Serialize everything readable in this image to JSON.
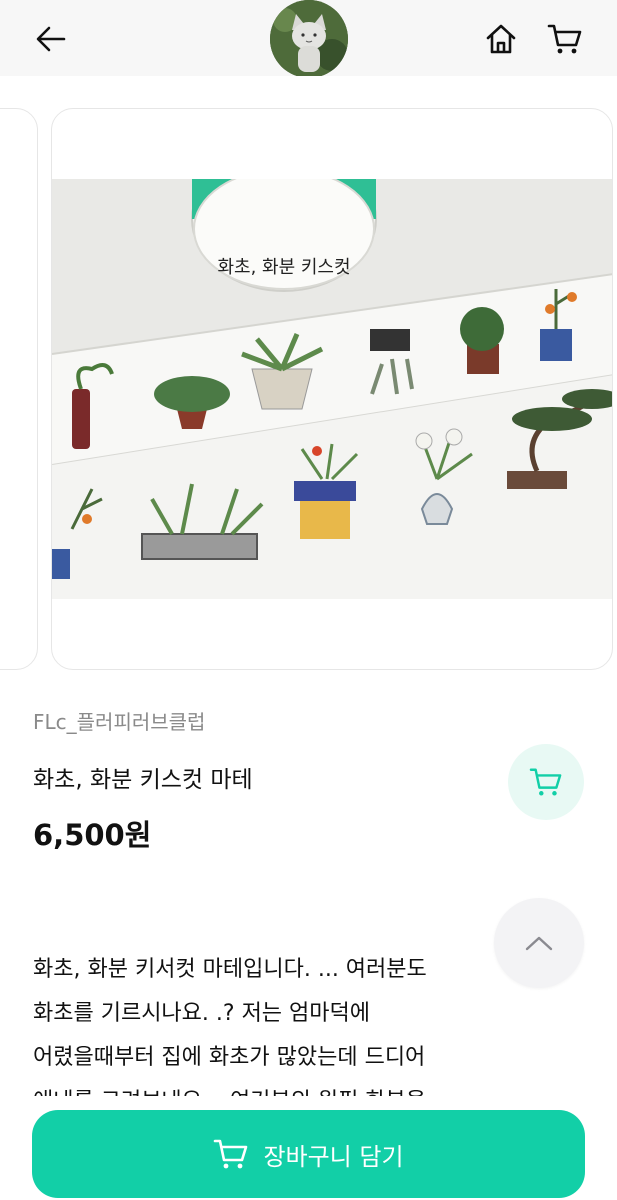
{
  "header": {
    "back_icon": "arrow-left-icon",
    "avatar_icon": "cat-figure-avatar",
    "home_icon": "home-icon",
    "cart_icon": "cart-icon"
  },
  "product": {
    "seller": "FLc_플러피러브클럽",
    "name": "화초, 화분 키스컷 마테",
    "price": "6,500원",
    "description_lines": [
      "화초, 화분 키서컷 마테입니다. ... 여러분도",
      "화초를 기르시나요. .? 저는 엄마덕에",
      "어렸을때부터 집에 화초가 많았는데 드디어",
      "애네를 그려보네요... 여기분의 원필 화분을"
    ],
    "tape_label": "화초, 화분 키스컷"
  },
  "actions": {
    "add_to_cart_label": "장바구니 담기",
    "scroll_top_icon": "chevron-up-icon"
  },
  "colors": {
    "accent": "#12cfa7",
    "accent_soft": "#e8f9f4",
    "header_bg": "#f7f7f7"
  }
}
